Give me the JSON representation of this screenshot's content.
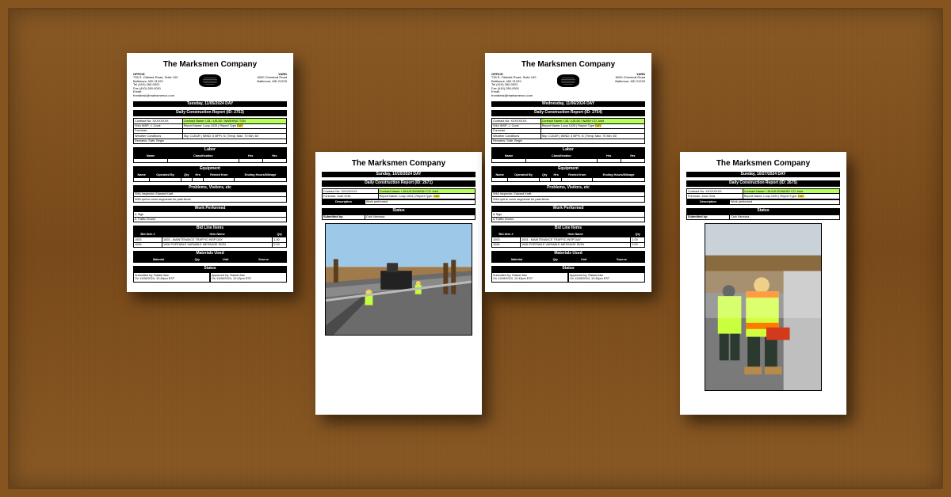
{
  "company": "The Marksmen Company",
  "office": {
    "label": "OFFICE",
    "addr1": "735 S. Oldwick Road, Suite 100",
    "addr2": "Baltimore, MD 21229",
    "phone": "Tel (410) 260-0001",
    "fax": "Fax (410) 260-0001",
    "email": "Email: frontdesk@marksmenco.com"
  },
  "yard": {
    "label": "YARD",
    "addr1": "6000 Chemical Road",
    "addr2": "Baltimore, MD 21229"
  },
  "sheets": {
    "r1": {
      "date_bar": "Tuesday, 11/05/2024 DAY",
      "report_bar": "Daily Construction Report (ID: 2753)",
      "contract_no": "Contract No: XXXXXXXX",
      "contract_name": "Contract Name: I-81 / US-50 / WASHING TON",
      "sha_insp": "SHA INSP: J. Cook",
      "report_name": "Report Name: Loop 1025",
      "report_type_lbl": "Report Type",
      "report_type": "DAY",
      "foreman": "Foreman: ",
      "weather": "Weather Conditions",
      "sky": "Sky: CLEAR",
      "wind": "WIND: 5 MPH, N",
      "temp": "Temp: Max: 70 Min: 60",
      "remarks": "Remarks: Safe, Begin",
      "sec_labor": "Labor",
      "labor_h": [
        "Name",
        "Classification",
        "Hrs",
        "Hrs"
      ],
      "sec_equip": "Equipment",
      "equip_h": [
        "Name",
        "Operated By",
        "Qty",
        "Hrs",
        "Rented from",
        "Ending Hours/Mileage"
      ],
      "sec_problems": "Problems, Visitors, etc",
      "problems1": "SHA Inspector: Edward Kraft",
      "problems2": "SHA quit to cover segments for past items",
      "sec_work": "Work Performed",
      "work1": "& Sign",
      "work2": "& Traffic Drums",
      "sec_bid": "Bid Line Items",
      "bid_h": [
        "Bid Item #",
        "Item Name",
        "Qty"
      ],
      "bid_r1": [
        "1003",
        "1003 - MAINTENANCE TRAFFIC INSP DAY",
        "1.00"
      ],
      "bid_r2": [
        "1006",
        "1006 PORTABLE VARIABLE MESSAGE SIGN",
        "2.00"
      ],
      "sec_mat": "Materials Used",
      "mat_h": [
        "Material",
        "Qty",
        "Unit",
        "Source"
      ],
      "sec_status": "Status",
      "status_sub_lbl": "Submitted by: Rafael Aka",
      "status_sub_ts": "On 11/08/2024, 12:43pm EST",
      "status_app_lbl": "Approved by: Rafael Aka",
      "status_app_ts": "On 11/08/2024, 12:43pm EST"
    },
    "r2": {
      "date_bar": "Sunday, 10/20/2024 DAY",
      "report_bar": "Daily Construction Report (ID: 2671)",
      "contract_no": "Contract No: XXXXXXXX",
      "contract_name": "Contract Name: I-81/US-50/WASH CO Joint",
      "foreman_lbl": "Foreman: José Ortiz",
      "report_name": "Report Name: Loop 1024",
      "report_type_lbl": "Report Type:",
      "report_type": "DAY",
      "desc_lbl": "Description",
      "desc": "Work performed",
      "status_bar": "Status",
      "sub_lbl": "Submitted by:",
      "sub_val": "Cain Vanessa"
    },
    "r3": {
      "date_bar": "Wednesday, 11/06/2024 DAY",
      "report_bar": "Daily Construction Report (ID: 2754)",
      "contract_no": "Contract No: XXXXXXXX",
      "contract_name": "Contract Name: I-81 / US-50 / WASH CO Joint",
      "sha_insp": "SHA INSP: J. Cook",
      "report_name": "Report Name: Loop 1025",
      "report_type_lbl": "Report Type",
      "report_type": "DAY",
      "foreman": "Foreman:",
      "weather": "Weather Conditions",
      "sky": "Sky: CLEAR",
      "wind": "WIND: 5 MPH, N",
      "temp": "Temp: Max: 70 Min: 60",
      "remarks": "Remarks: Safe, Begin",
      "sec_labor": "Labor",
      "labor_h": [
        "Name",
        "Classification",
        "Hrs",
        "Hrs"
      ],
      "sec_equip": "Equipment",
      "equip_h": [
        "Name",
        "Operated By",
        "Qty",
        "Hrs",
        "Rented from",
        "Ending Hours/Mileage"
      ],
      "sec_problems": "Problems, Visitors, etc",
      "problems1": "SHA Inspector: Edward Kraft",
      "problems2": "SHA quit to cover segments for past items",
      "sec_work": "Work Performed",
      "work1": "& Sign",
      "work2": "& Traffic Drums",
      "sec_bid": "Bid Line Items",
      "bid_h": [
        "Bid Item #",
        "Item Name",
        "Qty"
      ],
      "bid_r1": [
        "1003",
        "1003 - MAINTENANCE TRAFFIC INSP DAY",
        "1.00"
      ],
      "bid_r2": [
        "1006",
        "1006 PORTABLE VARIABLE MESSAGE SIGN",
        "2.00"
      ],
      "sec_mat": "Materials Used",
      "mat_h": [
        "Material",
        "Qty",
        "Unit",
        "Source"
      ],
      "sec_status": "Status",
      "status_sub_lbl": "Submitted by: Rafael Aka",
      "status_sub_ts": "On 11/08/2024, 12:43pm EST",
      "status_app_lbl": "Approved by: Rafael Aka",
      "status_app_ts": "On 11/08/2024, 12:43pm EST"
    },
    "r4": {
      "date_bar": "Sunday, 10/27/2024 DAY",
      "report_bar": "Daily Construction Report (ID: 2675)",
      "contract_no": "Contract No: XXXXXXXX",
      "contract_name": "Contract Name: I-81/US-50/WASH CO Joint",
      "foreman_lbl": "Foreman: José Ortiz",
      "report_name": "Report Name: Loop 1024",
      "report_type_lbl": "Report Type:",
      "report_type": "DAY",
      "desc_lbl": "Description",
      "desc": "Work performed",
      "status_bar": "Status",
      "sub_lbl": "Submitted by:",
      "sub_val": "Cain Vanessa"
    }
  }
}
